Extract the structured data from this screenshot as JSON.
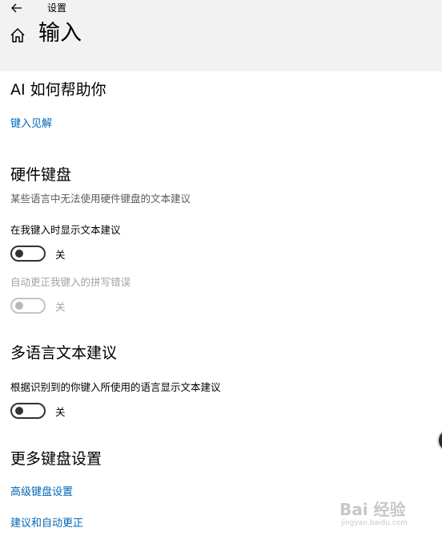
{
  "window": {
    "title": "设置"
  },
  "page": {
    "title": "输入"
  },
  "sections": {
    "ai": {
      "title": "AI 如何帮助你",
      "link": "键入见解"
    },
    "hardware": {
      "title": "硬件键盘",
      "description": "某些语言中无法使用硬件键盘的文本建议",
      "setting1_label": "在我键入时显示文本建议",
      "setting1_state": "关",
      "setting2_label": "自动更正我键入的拼写错误",
      "setting2_state": "关"
    },
    "multilang": {
      "title": "多语言文本建议",
      "setting_label": "根据识别到的你键入所使用的语言显示文本建议",
      "setting_state": "关"
    },
    "more": {
      "title": "更多键盘设置",
      "link1": "高级键盘设置",
      "link2": "建议和自动更正"
    }
  },
  "watermark": {
    "brand": "Bai 经验",
    "sub": "jingyan.baidu.com"
  },
  "colors": {
    "accent_link": "#0067b8",
    "header_bg": "#f2f2f2",
    "toggle_off": "#333333",
    "disabled": "#a3a3a3"
  },
  "icons": {
    "back": "arrow-left-icon",
    "home": "home-icon"
  }
}
